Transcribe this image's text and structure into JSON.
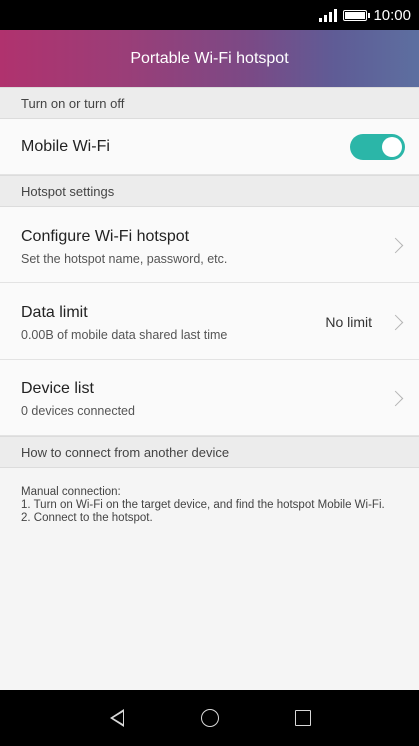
{
  "status_bar": {
    "time": "10:00"
  },
  "header": {
    "title": "Portable Wi-Fi hotspot"
  },
  "sections": {
    "toggle_section": "Turn on or turn off",
    "hotspot_settings": "Hotspot settings",
    "how_to_connect": "How to connect from another device"
  },
  "mobile_wifi": {
    "label": "Mobile Wi-Fi",
    "enabled": true
  },
  "configure": {
    "title": "Configure Wi-Fi hotspot",
    "subtitle": "Set the hotspot name, password, etc."
  },
  "data_limit": {
    "title": "Data limit",
    "subtitle": "0.00B of mobile data shared last time",
    "value": "No limit"
  },
  "device_list": {
    "title": "Device list",
    "subtitle": "0 devices connected"
  },
  "instructions": {
    "line1": "Manual connection:",
    "line2": "1. Turn on Wi-Fi on the target device, and find the hotspot Mobile Wi-Fi.",
    "line3": "2. Connect to the hotspot."
  },
  "colors": {
    "accent": "#2bb6a8",
    "header_start": "#b0326e",
    "header_end": "#5d6fa0"
  },
  "icons": [
    "signal-icon",
    "battery-icon",
    "chevron-right-icon",
    "back-icon",
    "home-icon",
    "recent-apps-icon"
  ]
}
